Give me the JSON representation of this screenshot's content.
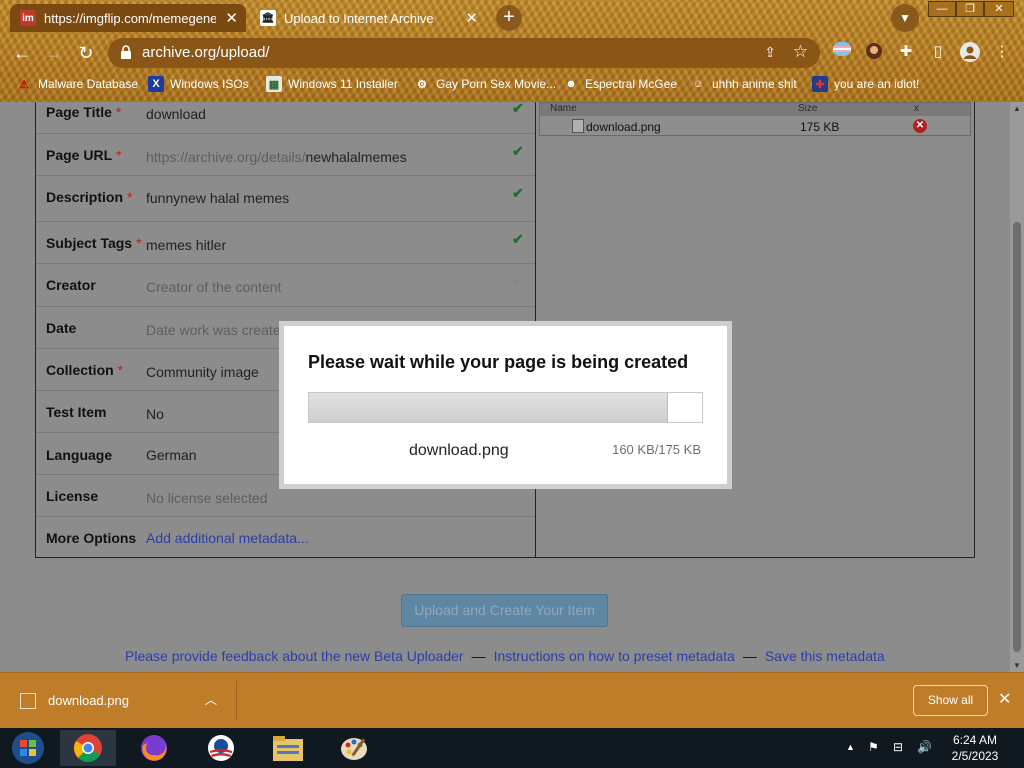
{
  "browser": {
    "tabs": [
      {
        "label": "https://imgflip.com/memegenerat",
        "favicon": "imgflip-favicon"
      },
      {
        "label": "Upload to Internet Archive",
        "favicon": "archive-favicon"
      }
    ],
    "address": "archive.org/upload/",
    "bookmarks": [
      {
        "label": "Malware Database"
      },
      {
        "label": "Windows ISOs"
      },
      {
        "label": "Windows 11 Installer"
      },
      {
        "label": "Gay Porn Sex Movie..."
      },
      {
        "label": "Espectral McGee"
      },
      {
        "label": "uhhh anime shit"
      },
      {
        "label": "you are an idiot!"
      }
    ]
  },
  "form": {
    "rows": [
      {
        "label": "Page Title",
        "required": "*",
        "value": "download",
        "placeholder": false,
        "checked": true
      },
      {
        "label": "Page URL",
        "required": "*",
        "value_prefix": "https://archive.org/details/",
        "value": "newhalalmemes",
        "checked": true
      },
      {
        "label": "Description",
        "required": "*",
        "value": "funnynew halal memes",
        "placeholder": false,
        "checked": true
      },
      {
        "label": "Subject Tags",
        "required": "*",
        "value": "memes hitler",
        "placeholder": false,
        "checked": true
      },
      {
        "label": "Creator",
        "required": "",
        "value": "Creator of the content",
        "placeholder": true,
        "checked": false
      },
      {
        "label": "Date",
        "required": "",
        "value": "Date work was create",
        "placeholder": true,
        "checked": false
      },
      {
        "label": "Collection",
        "required": "*",
        "value": "Community image",
        "placeholder": false
      },
      {
        "label": "Test Item",
        "required": "",
        "value": "No",
        "placeholder": false
      },
      {
        "label": "Language",
        "required": "",
        "value": "German",
        "placeholder": false
      },
      {
        "label": "License",
        "required": "",
        "value": "No license selected",
        "placeholder": true
      },
      {
        "label": "More Options",
        "required": "",
        "value": "Add additional metadata...",
        "link": true
      }
    ]
  },
  "files": {
    "headers": [
      "Name",
      "Size",
      "x"
    ],
    "rows": [
      {
        "name": "download.png",
        "size": "175 KB"
      }
    ]
  },
  "upload_button": "Upload and Create Your Item",
  "footer_links": [
    "Please provide feedback about the new Beta Uploader",
    "Instructions on how to preset metadata",
    "Save this metadata"
  ],
  "footer_separator": "—",
  "modal": {
    "title": "Please wait while your page is being created",
    "progress": 0.914,
    "filename": "download.png",
    "size_text": "160 KB/175 KB"
  },
  "download_bar": {
    "filename": "download.png",
    "show_all": "Show all"
  },
  "taskbar": {
    "time": "6:24 AM",
    "date": "2/5/2023"
  },
  "colors": {
    "theme_orange": "#bf7d2a",
    "link_blue": "#2b3fa8",
    "required_red": "#b22222",
    "check_green": "#1f6d2c"
  }
}
